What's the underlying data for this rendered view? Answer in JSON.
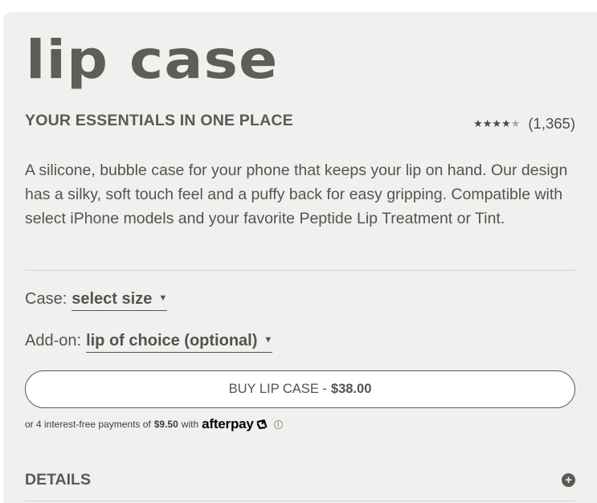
{
  "product": {
    "title": "lip case",
    "tagline": "YOUR ESSENTIALS IN ONE PLACE",
    "rating_value": 4.5,
    "review_count": "(1,365)",
    "description": "A silicone, bubble case for your phone that keeps your lip on hand. Our design has a silky, soft touch feel and a puffy back for easy gripping. Compatible with select iPhone models and your favorite Peptide Lip Treatment or Tint."
  },
  "options": {
    "case_label": "Case:",
    "case_value": "select size",
    "addon_label": "Add-on:",
    "addon_value": "lip of choice (optional)"
  },
  "buy": {
    "label": "BUY LIP CASE -",
    "price": "$38.00"
  },
  "afterpay": {
    "prefix": "or 4 interest-free payments of",
    "amount": "$9.50",
    "with": "with",
    "brand": "afterpay"
  },
  "details": {
    "label": "DETAILS"
  }
}
